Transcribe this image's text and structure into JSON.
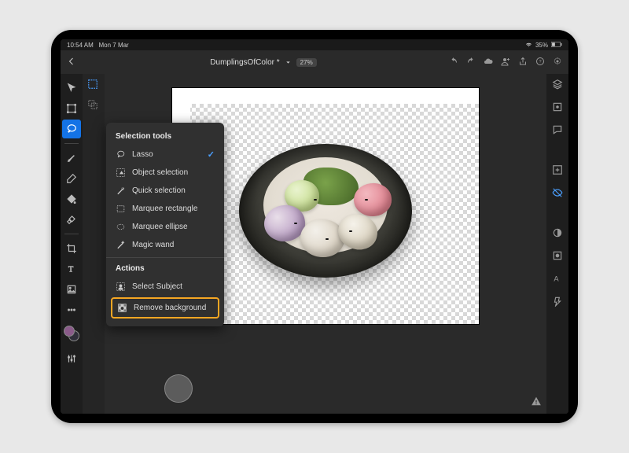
{
  "status": {
    "time": "10:54 AM",
    "date": "Mon 7 Mar",
    "battery": "35%"
  },
  "document": {
    "title": "DumplingsOfColor *",
    "zoom": "27%"
  },
  "popover": {
    "section1_label": "Selection tools",
    "tools": {
      "lasso": "Lasso",
      "object_selection": "Object selection",
      "quick_selection": "Quick selection",
      "marquee_rect": "Marquee rectangle",
      "marquee_ellipse": "Marquee ellipse",
      "magic_wand": "Magic wand"
    },
    "selected_tool_check": "✓",
    "section2_label": "Actions",
    "actions": {
      "select_subject": "Select Subject",
      "remove_background": "Remove background"
    }
  }
}
